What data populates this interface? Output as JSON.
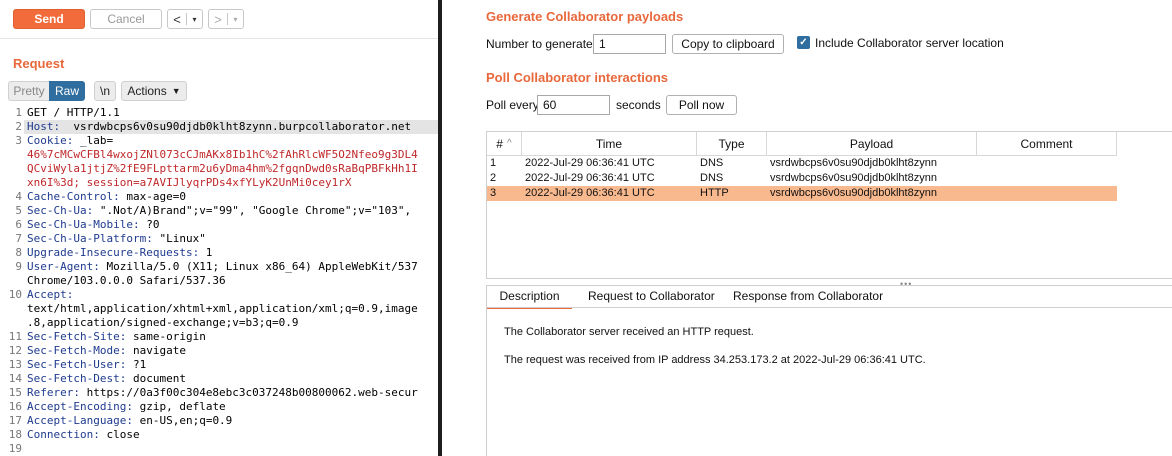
{
  "toolbar": {
    "send_label": "Send",
    "cancel_label": "Cancel",
    "back_arrow": "<",
    "forward_arrow": ">",
    "dropdown_glyph": "▾"
  },
  "request": {
    "title": "Request",
    "views": {
      "pretty": "Pretty",
      "raw": "Raw",
      "newline": "\\n",
      "actions": "Actions"
    },
    "lines": [
      {
        "n": "1",
        "name": "",
        "value": "GET / HTTP/1.1"
      },
      {
        "n": "2",
        "name": "Host:",
        "value": "  vsrdwbcps6v0su90djdb0klht8zynn.burpcollaborator.net"
      },
      {
        "n": "3",
        "name": "Cookie:",
        "value": " _lab="
      },
      {
        "n": "",
        "name": "",
        "value": "46%7cMCwCFBl4wxojZNl073cCJmAKx8Ib1hC%2fAhRlcWF5O2Nfeo9g3DL4",
        "cookie": true
      },
      {
        "n": "",
        "name": "",
        "value": "QCviWyla1jtjZ%2fE9FLpttarm2u6yDma4hm%2fgqnDwd0sRaBqPBFkHh1I",
        "cookie": true
      },
      {
        "n": "",
        "name": "",
        "value": "xn6I%3d; session=a7AVIJlyqrPDs4xfYLyK2UnMi0cey1rX",
        "cookie": true
      },
      {
        "n": "4",
        "name": "Cache-Control:",
        "value": " max-age=0"
      },
      {
        "n": "5",
        "name": "Sec-Ch-Ua:",
        "value": " \".Not/A)Brand\";v=\"99\", \"Google Chrome\";v=\"103\","
      },
      {
        "n": "6",
        "name": "Sec-Ch-Ua-Mobile:",
        "value": " ?0"
      },
      {
        "n": "7",
        "name": "Sec-Ch-Ua-Platform:",
        "value": " \"Linux\""
      },
      {
        "n": "8",
        "name": "Upgrade-Insecure-Requests:",
        "value": " 1"
      },
      {
        "n": "9",
        "name": "User-Agent:",
        "value": " Mozilla/5.0 (X11; Linux x86_64) AppleWebKit/537"
      },
      {
        "n": "",
        "name": "",
        "value": "Chrome/103.0.0.0 Safari/537.36"
      },
      {
        "n": "10",
        "name": "Accept:",
        "value": ""
      },
      {
        "n": "",
        "name": "",
        "value": "text/html,application/xhtml+xml,application/xml;q=0.9,image"
      },
      {
        "n": "",
        "name": "",
        "value": ".8,application/signed-exchange;v=b3;q=0.9"
      },
      {
        "n": "11",
        "name": "Sec-Fetch-Site:",
        "value": " same-origin"
      },
      {
        "n": "12",
        "name": "Sec-Fetch-Mode:",
        "value": " navigate"
      },
      {
        "n": "13",
        "name": "Sec-Fetch-User:",
        "value": " ?1"
      },
      {
        "n": "14",
        "name": "Sec-Fetch-Dest:",
        "value": " document"
      },
      {
        "n": "15",
        "name": "Referer:",
        "value": " https://0a3f00c304e8ebc3c037248b00800062.web-secur"
      },
      {
        "n": "16",
        "name": "Accept-Encoding:",
        "value": " gzip, deflate"
      },
      {
        "n": "17",
        "name": "Accept-Language:",
        "value": " en-US,en;q=0.9"
      },
      {
        "n": "18",
        "name": "Connection:",
        "value": " close"
      },
      {
        "n": "19",
        "name": "",
        "value": ""
      }
    ]
  },
  "generate": {
    "title": "Generate Collaborator payloads",
    "number_label": "Number to generate:",
    "number_value": "1",
    "copy_button": "Copy to clipboard",
    "include_label": "Include Collaborator server location",
    "include_checked": true
  },
  "poll": {
    "title": "Poll Collaborator interactions",
    "every_label": "Poll every",
    "every_value": "60",
    "seconds_label": "seconds",
    "poll_now_button": "Poll now"
  },
  "table": {
    "columns": [
      "#",
      "Time",
      "Type",
      "Payload",
      "Comment"
    ],
    "sort_glyph": "^",
    "rows": [
      {
        "id": "1",
        "time": "2022-Jul-29 06:36:41 UTC",
        "type": "DNS",
        "payload": "vsrdwbcps6v0su90djdb0klht8zynn",
        "comment": "",
        "selected": false
      },
      {
        "id": "2",
        "time": "2022-Jul-29 06:36:41 UTC",
        "type": "DNS",
        "payload": "vsrdwbcps6v0su90djdb0klht8zynn",
        "comment": "",
        "selected": false
      },
      {
        "id": "3",
        "time": "2022-Jul-29 06:36:41 UTC",
        "type": "HTTP",
        "payload": "vsrdwbcps6v0su90djdb0klht8zynn",
        "comment": "",
        "selected": true
      }
    ]
  },
  "details": {
    "tabs": [
      "Description",
      "Request to Collaborator",
      "Response from Collaborator"
    ],
    "active_tab": "Description",
    "line1": "The Collaborator server received an HTTP request.",
    "line2": "The request was received from IP address 34.253.173.2 at 2022-Jul-29 06:36:41 UTC."
  },
  "colors": {
    "accent": "#e8683b",
    "send": "#f26b3a",
    "raw_active": "#2f6e9e",
    "selected_row": "#f9b98e"
  }
}
